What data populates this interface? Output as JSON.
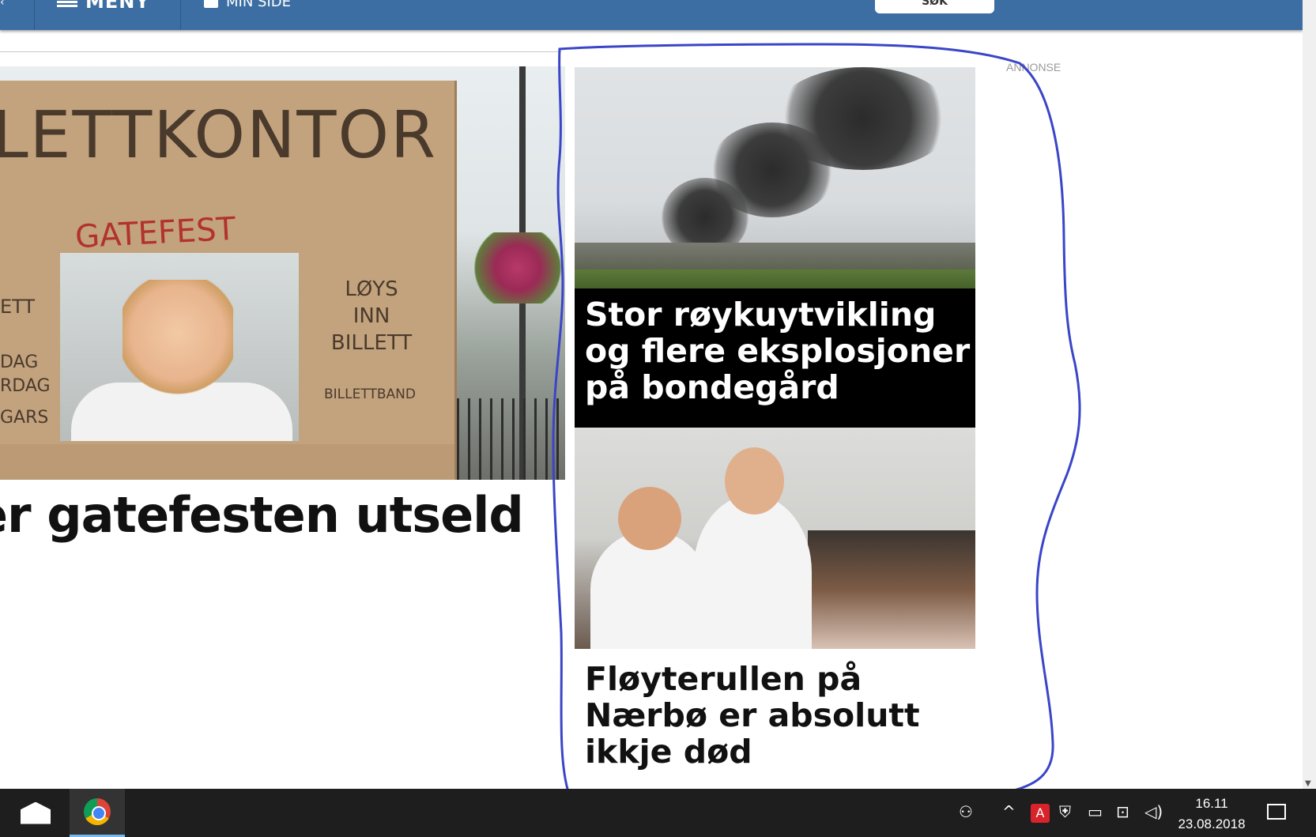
{
  "nav": {
    "menu_label": "MENY",
    "minside_label": "MIN SIDE",
    "search_label": "SØK"
  },
  "main_article": {
    "headline": "er gatefesten utseld",
    "sign_top": "LETTKONTOR",
    "sign_sub": "GATEFEST",
    "sign_right": "LØYS INN BILLETT",
    "sign_band": "BILLETTBAND",
    "sign_left_lines": [
      "ETT",
      "DAG",
      "RDAG",
      "GARS"
    ]
  },
  "sidebar": {
    "ad_label": "ANNONSE",
    "teasers": [
      {
        "title": "Stor røykuytvikling og flere eksplosjoner på bondegård"
      },
      {
        "title": "Fløyterullen på Nærbø er absolutt ikkje død"
      }
    ],
    "annotation_color": "#3a45c8"
  },
  "taskbar": {
    "time": "16.11",
    "date": "23.08.2018",
    "apps": [
      "mail",
      "chrome"
    ]
  },
  "colors": {
    "nav_bg": "#3c6ea3",
    "taskbar_bg": "#1e1e1e"
  }
}
